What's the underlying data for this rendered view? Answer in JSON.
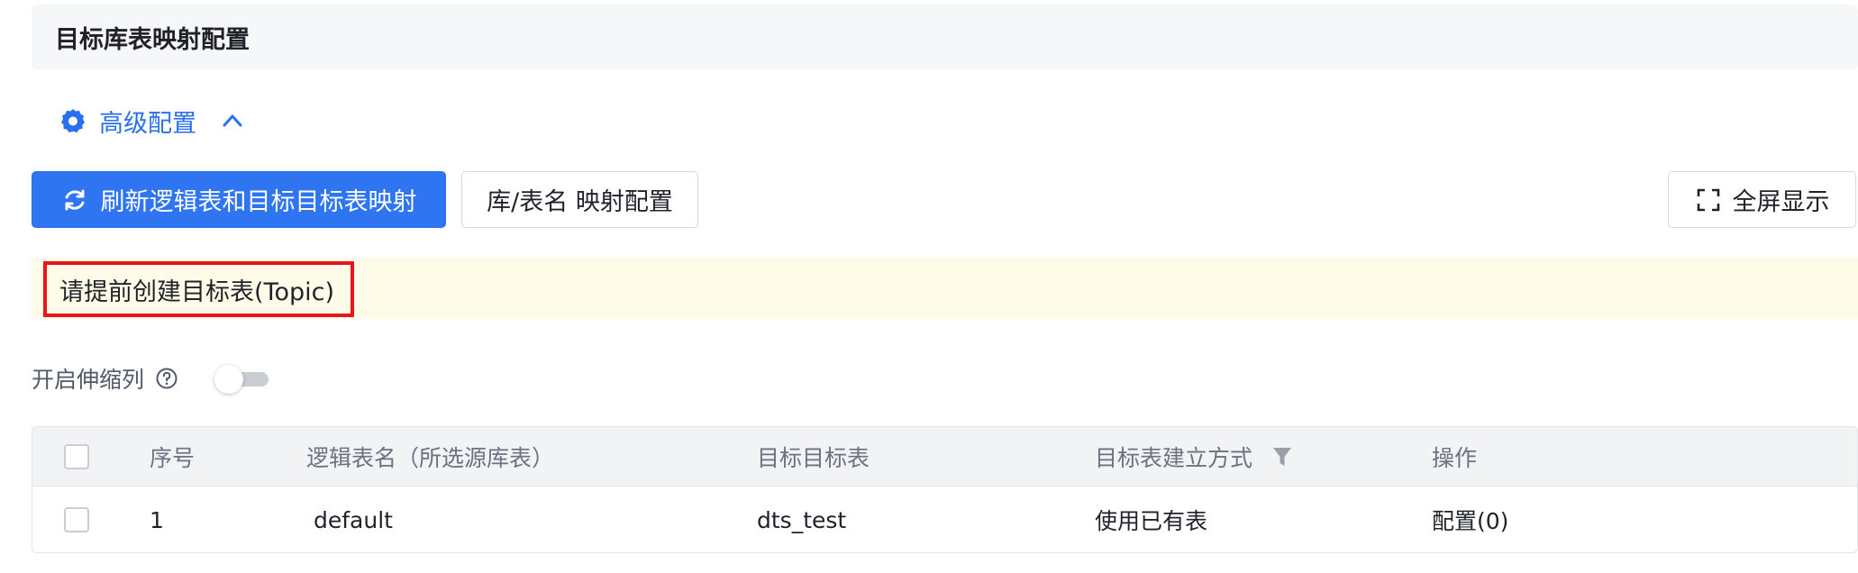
{
  "header": {
    "title": "目标库表映射配置"
  },
  "advanced": {
    "label": "高级配置",
    "icon": "gear-icon",
    "expanded_icon": "chevron-up-icon"
  },
  "toolbar": {
    "refresh_label": "刷新逻辑表和目标目标表映射",
    "mapping_label": "库/表名 映射配置",
    "fullscreen_label": "全屏显示"
  },
  "notice": {
    "text": "请提前创建目标表(Topic)"
  },
  "switch": {
    "label": "开启伸缩列",
    "enabled": false
  },
  "table": {
    "columns": [
      "序号",
      "逻辑表名（所选源库表）",
      "目标目标表",
      "目标表建立方式",
      "操作"
    ],
    "rows": [
      {
        "index": "1",
        "logical_table": "default",
        "target_table": "dts_test",
        "create_mode": "使用已有表",
        "action": "配置(0)"
      }
    ]
  },
  "colors": {
    "primary": "#2f74f0",
    "link": "#2a6ff2",
    "notice_bg": "#fffbe9",
    "highlight_border": "#e8151b"
  }
}
